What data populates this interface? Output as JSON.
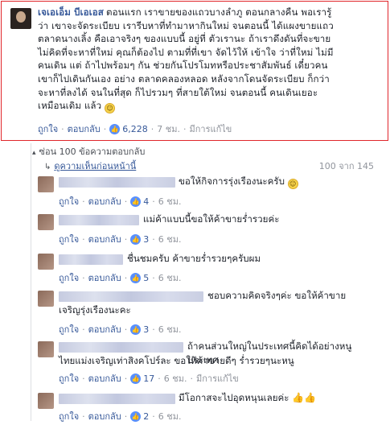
{
  "main_comment": {
    "author": "เจเอเอ็ม บีเอเอส",
    "lines": [
      "ตอนแรก เราขายของแถวบางลำภู ตอนกลางคืน พอเรารู้",
      "ว่า เขาจะจัดระเบียบ เรารีบหาที่ทำมาหากินใหม่ จนตอนนี้ ได้แผงขายแถว",
      "ตลาดนางเลิ้ง คือเอาจริงๆ ของแบบนี้ อยู่ที่ ตัวเรานะ ถ้าเราดึงดันที่จะขาย",
      "ไม่คิดที่จะหาที่ใหม่ คุณก็ต้องไป ตามที่ที่เขา จัดไว้ให้ เข้าใจ ว่าที่ใหม่ ไม่มี",
      "คนเดิน แต่ ถ้าไปพร้อมๆ กัน ช่วยกันโปรโมทหรือประชาสัมพันธ์ เดี๋ยวคน",
      "เขาก็ไปเดินกันเอง อย่าง ตลาดคลองหลอด หลังจากโดนจัดระเบียบ ก็กว่า",
      "จะหาที่ลงได้ จนในที่สุด ก็ไปรวมๆ ที่สายใต้ใหม่ จนตอนนี้ คนเดินเยอะ",
      "เหมือนเดิม แล้ว"
    ],
    "emoji": "smiley-emoji",
    "like_label": "ถูกใจ",
    "reply_label": "ตอบกลับ",
    "likes": "6,228",
    "time": "7 ชม.",
    "edited": "มีการแก้ไข"
  },
  "thread": {
    "hide_label": "ซ่อน 100 ข้อความตอบกลับ",
    "prev_label": "ดูความเห็นก่อนหน้านี้",
    "count": "100 จาก 145"
  },
  "replies": [
    {
      "lines": [
        "ขอให้กิจการรุ่งเรืองนะครับ"
      ],
      "emoji": "smiley-emoji",
      "likes": "4",
      "time": "6 ชม.",
      "edited": ""
    },
    {
      "lines": [
        "แม่ค้าแบบนี้ขอให้ค้าขายร่ำรวยค่ะ"
      ],
      "emoji": "",
      "likes": "3",
      "time": "6 ชม.",
      "edited": ""
    },
    {
      "lines": [
        "ชื่นชมครับ ค้าขายร่ำรวยๆครับผม"
      ],
      "emoji": "",
      "likes": "5",
      "time": "6 ชม.",
      "edited": ""
    },
    {
      "lines": [
        "ชอบความคิดจริงๆค่ะ ขอให้ค้าขาย",
        "เจริญรุ่งเรืองนะคะ"
      ],
      "emoji": "",
      "likes": "3",
      "time": "6 ชม.",
      "edited": ""
    },
    {
      "lines": [
        "ถ้าคนส่วนใหญ่ในประเทศนี้คิดได้อย่างหนู ประเทศ",
        "ไทยแม่งเจริญเท่าสิงคโปร์ละ ขอให้ค้าขายดีๆ ร่ำรวยๆนะหนู"
      ],
      "emoji": "",
      "likes": "17",
      "time": "6 ชม.",
      "edited": "มีการแก้ไข"
    },
    {
      "lines": [
        "มีโอกาสจะไปอุดหนุนเลยค่ะ"
      ],
      "emoji": "thumbs-up-emoji",
      "likes": "2",
      "time": "6 ชม.",
      "edited": ""
    }
  ],
  "labels": {
    "like": "ถูกใจ",
    "reply": "ตอบกลับ"
  }
}
